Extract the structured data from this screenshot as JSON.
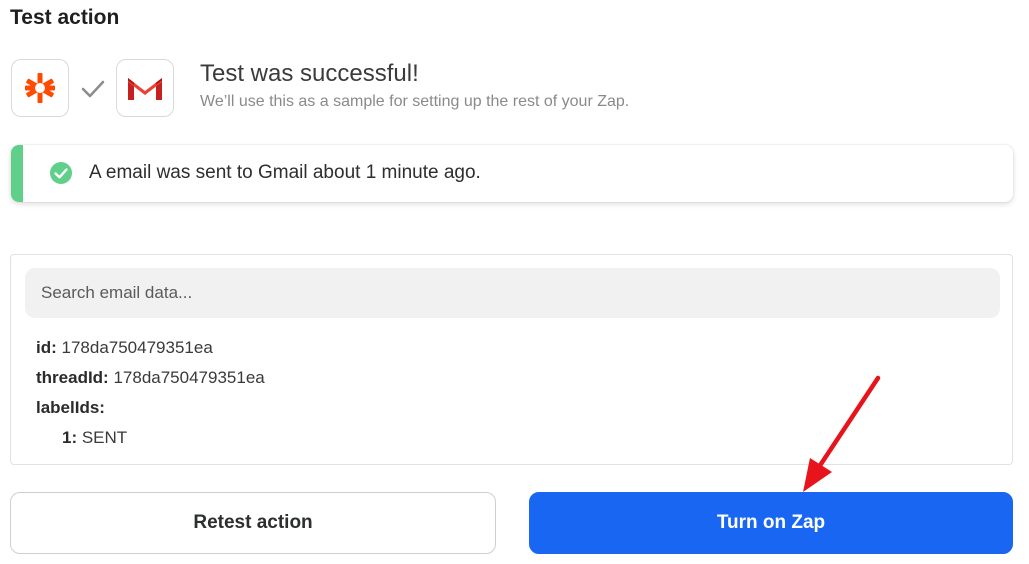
{
  "section": {
    "title": "Test action"
  },
  "apps": {
    "trigger_icon": "zapier-asterisk-icon",
    "action_icon": "gmail-icon",
    "connector_icon": "checkmark-icon",
    "zapier_color": "#ff4a00",
    "gmail_color": "#d93025"
  },
  "result": {
    "title": "Test was successful!",
    "subtitle": "We’ll use this as a sample for setting up the rest of your Zap."
  },
  "alert": {
    "message": "A email was sent to Gmail about 1 minute ago.",
    "accent_color": "#5fcf8a"
  },
  "data_panel": {
    "search_placeholder": "Search email data...",
    "fields": [
      {
        "key": "id:",
        "value": " 178da750479351ea"
      },
      {
        "key": "threadId:",
        "value": " 178da750479351ea"
      },
      {
        "key": "labelIds:",
        "value": ""
      },
      {
        "key": "1:",
        "value": " SENT"
      }
    ]
  },
  "buttons": {
    "retest_label": "Retest action",
    "turn_on_label": "Turn on Zap",
    "primary_color": "#1866f2"
  },
  "annotation": {
    "arrow_color": "#e8141b"
  }
}
